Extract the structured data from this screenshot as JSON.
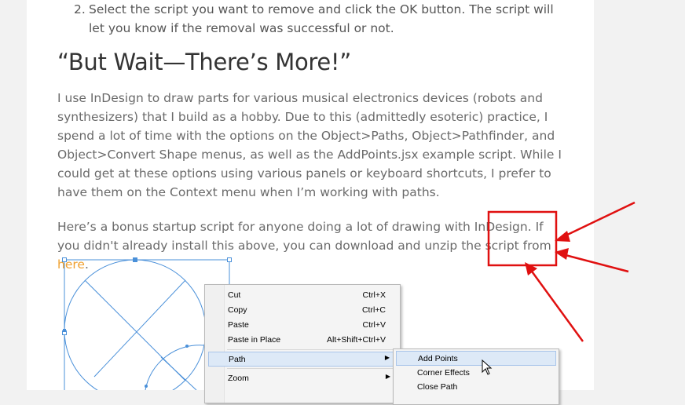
{
  "article": {
    "step2": {
      "number": "2.",
      "text": "Select the script you want to remove and click the OK button. The script will let you know if the removal was successful or not."
    },
    "heading": "“But Wait—There’s More!”",
    "paragraph1": "I use InDesign to draw parts for various musical electronics devices (robots and synthesizers) that I build as a hobby. Due to this (admittedly esoteric) practice, I spend a lot of time with the options on the Object>Paths, Object>Pathfinder, and Object>Convert Shape menus, as well as the AddPoints.jsx example script. While I could get at these options using various panels or keyboard shortcuts, I prefer to have them on the Context menu when I’m working with paths.",
    "paragraph2_text": "Here’s a bonus startup script for anyone doing a lot of drawing with InDesign. If you didn't already install this above, you can download and unzip the script from ",
    "paragraph2_link": "here",
    "paragraph2_end": "."
  },
  "context_menu": {
    "items": [
      {
        "label": "Cut",
        "shortcut": "Ctrl+X"
      },
      {
        "label": "Copy",
        "shortcut": "Ctrl+C"
      },
      {
        "label": "Paste",
        "shortcut": "Ctrl+V"
      },
      {
        "label": "Paste in Place",
        "shortcut": "Alt+Shift+Ctrl+V"
      },
      {
        "label": "Path",
        "arrow": "▶"
      },
      {
        "label": "Zoom",
        "arrow": "▶"
      }
    ]
  },
  "submenu": {
    "items": [
      {
        "label": "Add Points"
      },
      {
        "label": "Corner Effects"
      },
      {
        "label": "Close Path"
      }
    ]
  },
  "colors": {
    "link": "#f0a02f",
    "annotation": "#e01010",
    "path_stroke": "#4a90d9"
  }
}
